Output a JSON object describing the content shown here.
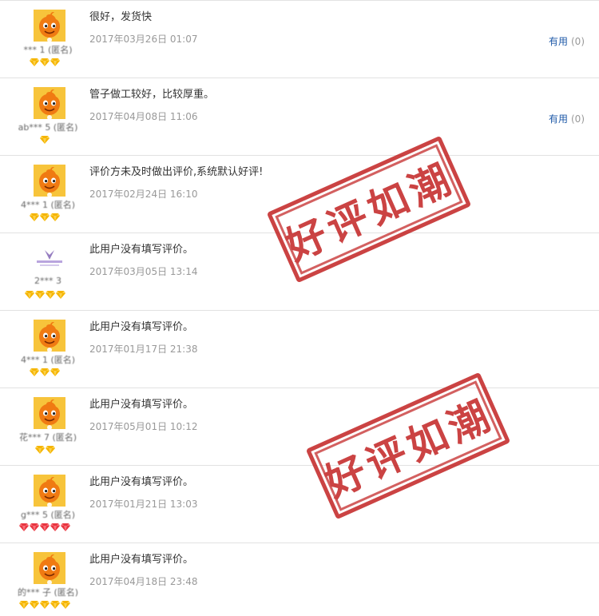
{
  "reviews": [
    {
      "user": "*** 1 (匿名)",
      "text": "很好，发货快",
      "date": "2017年03月26日 01:07",
      "avatar": "orange-mascot",
      "badge": "gold",
      "badge_count": 3,
      "show_useful": true
    },
    {
      "user": "ab*** 5 (匿名)",
      "text": "管子做工较好，比较厚重。",
      "date": "2017年04月08日 11:06",
      "avatar": "orange-mascot",
      "badge": "gold",
      "badge_count": 1,
      "show_useful": true
    },
    {
      "user": "4*** 1 (匿名)",
      "text": "评价方未及时做出评价,系统默认好评!",
      "date": "2017年02月24日 16:10",
      "avatar": "orange-mascot",
      "badge": "gold",
      "badge_count": 3,
      "show_useful": false
    },
    {
      "user": "2*** 3",
      "text": "此用户没有填写评价。",
      "date": "2017年03月05日 13:14",
      "avatar": "purple-logo",
      "badge": "gold",
      "badge_count": 4,
      "show_useful": false
    },
    {
      "user": "4*** 1 (匿名)",
      "text": "此用户没有填写评价。",
      "date": "2017年01月17日 21:38",
      "avatar": "orange-mascot",
      "badge": "gold",
      "badge_count": 3,
      "show_useful": false
    },
    {
      "user": "花*** 7 (匿名)",
      "text": "此用户没有填写评价。",
      "date": "2017年05月01日 10:12",
      "avatar": "orange-mascot",
      "badge": "gold",
      "badge_count": 2,
      "show_useful": false
    },
    {
      "user": "g*** 5 (匿名)",
      "text": "此用户没有填写评价。",
      "date": "2017年01月21日 13:03",
      "avatar": "orange-mascot",
      "badge": "red",
      "badge_count": 5,
      "show_useful": false
    },
    {
      "user": "的*** 子 (匿名)",
      "text": "此用户没有填写评价。",
      "date": "2017年04月18日 23:48",
      "avatar": "orange-mascot",
      "badge": "gold",
      "badge_count": 5,
      "show_useful": false
    }
  ],
  "useful": {
    "label": "有用",
    "count": "(0)"
  },
  "stamps": [
    {
      "text": "好评如潮"
    },
    {
      "text": "好评如潮"
    }
  ],
  "colors": {
    "divider": "#e2e2e2",
    "text": "#333333",
    "date": "#999999",
    "link": "#1f5aa8",
    "stamp": "#c01b1b",
    "gold_badge": "#f5b400",
    "red_badge": "#e8343f",
    "avatar_bg": "#f7c43b",
    "mascot": "#f07a12"
  }
}
